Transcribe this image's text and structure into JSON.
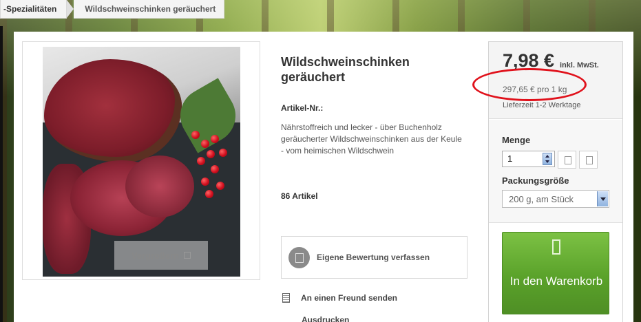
{
  "breadcrumb": {
    "items": [
      {
        "label": "-Spezialitäten"
      },
      {
        "label": "Wildschweinschinken geräuchert"
      }
    ]
  },
  "product": {
    "title": "Wildschweinschinken geräuchert",
    "article_nr_label": "Artikel-Nr.:",
    "description": "Nährstoffreich und lecker - über Buchenholz geräucherter Wildschweinschinken aus der Keule - vom heimischen Wildschwein",
    "stock": "86 Artikel",
    "zoom_label": "Vergrößern"
  },
  "review": {
    "label": "Eigene Bewertung verfassen"
  },
  "links": {
    "friend": "An einen Freund senden",
    "print": "Ausdrucken"
  },
  "buy_box": {
    "price": "7,98 €",
    "price_note": "inkl. MwSt.",
    "unit_price": "297,65 € pro 1 kg",
    "delivery": "Lieferzeit 1-2 Werktage",
    "quantity_label": "Menge",
    "quantity_value": "1",
    "package_label": "Packungsgröße",
    "package_selected": "200 g, am Stück",
    "cart_button": "In den Warenkorb"
  },
  "colors": {
    "cart_green": "#5aa22a",
    "annotation_red": "#e0111b"
  },
  "icons": {
    "zoom": "zoom-icon",
    "review": "review-icon",
    "friend": "mail-icon",
    "cart": "cart-icon"
  }
}
